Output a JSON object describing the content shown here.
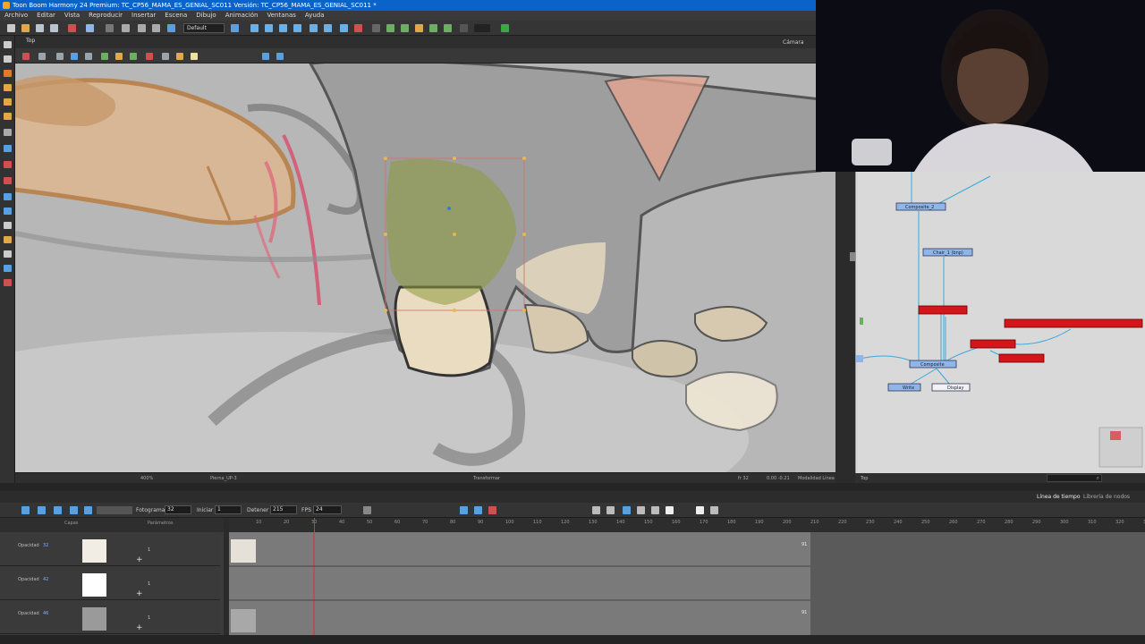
{
  "app": {
    "title": "Toon Boom Harmony 24 Premium: TC_CP56_MAMA_ES_GENIAL_SC011 Versión: TC_CP56_MAMA_ES_GENIAL_SC011 *"
  },
  "menu": [
    "Archivo",
    "Editar",
    "Vista",
    "Reproducir",
    "Insertar",
    "Escena",
    "Dibujo",
    "Animación",
    "Ventanas",
    "Ayuda"
  ],
  "toolbar": {
    "preset": "Default"
  },
  "viewer": {
    "tab_label": "Top",
    "camera_label": "Cámara",
    "zoom": "400%",
    "layer_name": "Pierna_UP-3",
    "mode": "Transformar",
    "frame_info": "fr 32",
    "coords": "0.00 -0.21",
    "tool_hint": "Modalidad Línea"
  },
  "node_view": {
    "nodes": [
      "Composite_2",
      "Chair_1 (bnp)",
      "Composite",
      "Display",
      "Write"
    ],
    "status_label": "Top",
    "search_icon": "search-icon"
  },
  "timeline": {
    "tabs": [
      "Línea de tiempo",
      "Librería de nodos"
    ],
    "frame_label": "Fotograma",
    "frame_value": "32",
    "start_label": "Iniciar",
    "start_value": "1",
    "stop_label": "Detener",
    "stop_value": "215",
    "fps_label": "FPS",
    "fps_value": "24",
    "layer_header_a": "Capas",
    "layer_header_b": "Parámetros",
    "ruler_ticks": [
      "10",
      "20",
      "30",
      "40",
      "50",
      "60",
      "70",
      "80",
      "90",
      "100",
      "110",
      "120",
      "130",
      "140",
      "150",
      "160",
      "170",
      "180",
      "190",
      "200",
      "210",
      "220",
      "230",
      "240",
      "250",
      "260",
      "270",
      "280",
      "290",
      "300",
      "310",
      "320",
      "330"
    ],
    "layers": [
      {
        "opacity_label": "Opacidad",
        "opacity": "32",
        "count": "1"
      },
      {
        "opacity_label": "Opacidad",
        "opacity": "42",
        "count": "1"
      },
      {
        "opacity_label": "Opacidad",
        "opacity": "46",
        "count": "1"
      }
    ],
    "end_markers": [
      "91",
      "91"
    ]
  },
  "colors": {
    "titlebar": "#0a63c9",
    "node_red": "#d4161b",
    "node_blue": "#8fb6e8",
    "selection": "#e8b84a",
    "playhead": "#e03030"
  }
}
